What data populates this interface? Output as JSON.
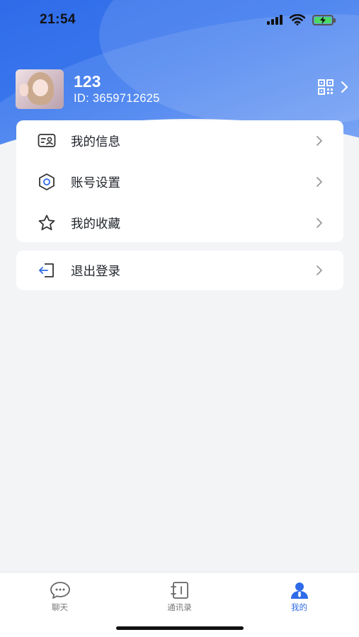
{
  "status_bar": {
    "time": "21:54"
  },
  "profile": {
    "name": "123",
    "id_text": "ID: 3659712625"
  },
  "menu_card": {
    "items": [
      {
        "label": "我的信息",
        "icon": "id-card-icon"
      },
      {
        "label": "账号设置",
        "icon": "hexagon-settings-icon"
      },
      {
        "label": "我的收藏",
        "icon": "star-icon"
      }
    ]
  },
  "logout_card": {
    "label": "退出登录",
    "icon": "logout-icon"
  },
  "tabbar": {
    "tabs": [
      {
        "label": "聊天",
        "icon": "chat-icon"
      },
      {
        "label": "通讯录",
        "icon": "contacts-icon"
      },
      {
        "label": "我的",
        "icon": "user-icon",
        "active": true
      }
    ]
  },
  "colors": {
    "accent": "#2f6be8",
    "header_gradient_start": "#2f6be8",
    "background": "#f3f4f6"
  }
}
